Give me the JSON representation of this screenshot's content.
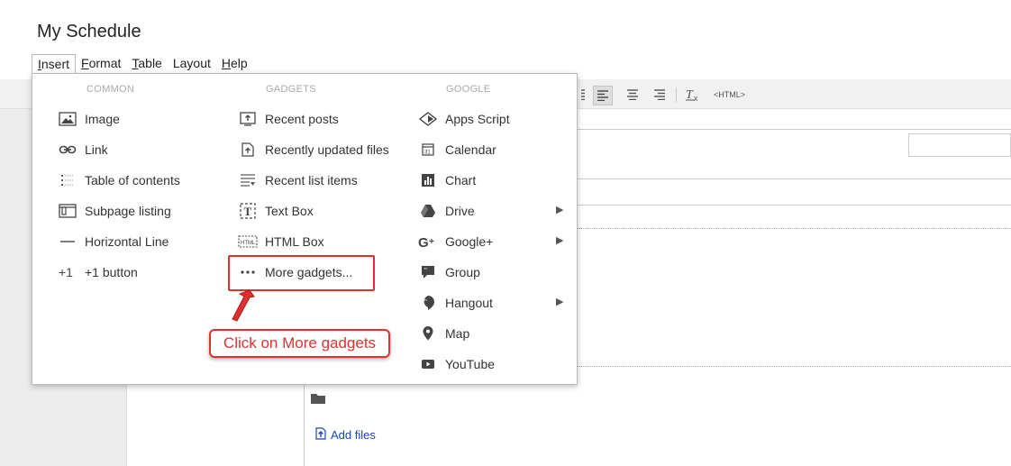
{
  "page": {
    "title": "My Schedule"
  },
  "menubar": [
    {
      "key": "insert",
      "label": "Insert",
      "underline": "I",
      "rest": "nsert"
    },
    {
      "key": "format",
      "label": "Format",
      "underline": "F",
      "rest": "ormat"
    },
    {
      "key": "table",
      "label": "Table",
      "underline": "T",
      "rest": "able"
    },
    {
      "key": "layout",
      "label": "Layout",
      "underline": "",
      "rest": "Layout"
    },
    {
      "key": "help",
      "label": "Help",
      "underline": "H",
      "rest": "elp"
    }
  ],
  "toolbar": {
    "html_label": "<HTML>"
  },
  "insert_menu": {
    "common": {
      "heading": "COMMON",
      "items": [
        {
          "label": "Image",
          "icon": "image-icon"
        },
        {
          "label": "Link",
          "icon": "link-icon"
        },
        {
          "label": "Table of contents",
          "icon": "table-of-contents-icon"
        },
        {
          "label": "Subpage listing",
          "icon": "subpage-listing-icon"
        },
        {
          "label": "Horizontal Line",
          "icon": "horizontal-line-icon"
        },
        {
          "label": "+1 button",
          "icon": "plus-one-icon"
        }
      ]
    },
    "gadgets": {
      "heading": "GADGETS",
      "items": [
        {
          "label": "Recent posts",
          "icon": "recent-posts-icon"
        },
        {
          "label": "Recently updated files",
          "icon": "recently-updated-files-icon"
        },
        {
          "label": "Recent list items",
          "icon": "recent-list-items-icon"
        },
        {
          "label": "Text Box",
          "icon": "text-box-icon"
        },
        {
          "label": "HTML Box",
          "icon": "html-box-icon"
        },
        {
          "label": "More gadgets...",
          "icon": "more-dots-icon"
        }
      ]
    },
    "google": {
      "heading": "GOOGLE",
      "items": [
        {
          "label": "Apps Script",
          "icon": "apps-script-icon"
        },
        {
          "label": "Calendar",
          "icon": "calendar-icon"
        },
        {
          "label": "Chart",
          "icon": "chart-icon"
        },
        {
          "label": "Drive",
          "icon": "drive-icon",
          "submenu": true
        },
        {
          "label": "Google+",
          "icon": "google-plus-icon",
          "submenu": true
        },
        {
          "label": "Group",
          "icon": "group-icon"
        },
        {
          "label": "Hangout",
          "icon": "hangout-icon",
          "submenu": true
        },
        {
          "label": "Map",
          "icon": "map-pin-icon"
        },
        {
          "label": "YouTube",
          "icon": "youtube-icon"
        }
      ]
    }
  },
  "annotation": {
    "callout_text": "Click on More gadgets",
    "color": "#e03030"
  },
  "content": {
    "add_files_label": "Add files"
  },
  "colors": {
    "accent_red": "#e03030",
    "link_blue": "#1a45b0",
    "menu_heading": "#aaaaaa"
  }
}
